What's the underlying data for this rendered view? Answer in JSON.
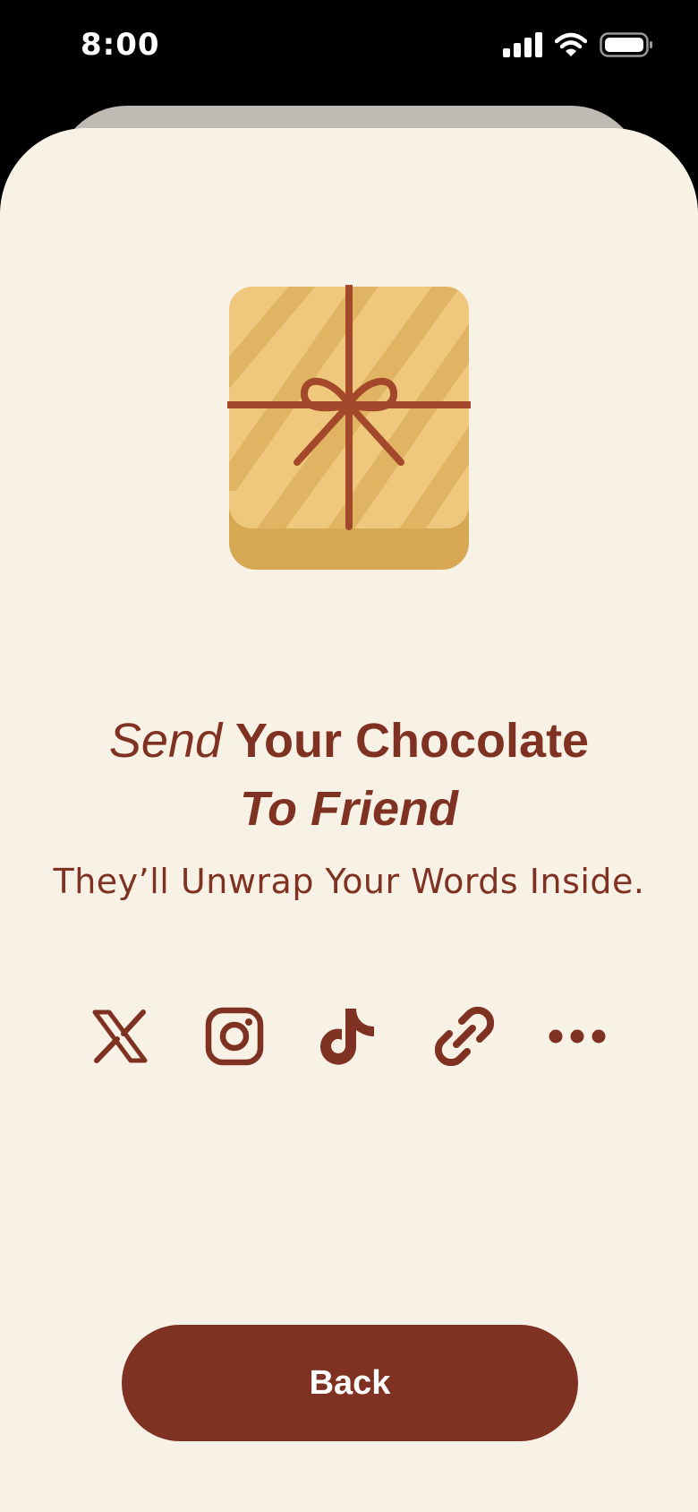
{
  "status_bar": {
    "time": "8:00",
    "icons": [
      "signal-icon",
      "wifi-icon",
      "battery-icon"
    ]
  },
  "headline": {
    "send": "Send",
    "your_chocolate": "Your Chocolate",
    "to_friend": "To Friend"
  },
  "subtitle": "They’ll Unwrap Your Words Inside.",
  "share_options": [
    "x-icon",
    "instagram-icon",
    "tiktok-icon",
    "link-icon",
    "more-icon"
  ],
  "buttons": {
    "back_label": "Back"
  },
  "colors": {
    "background": "#f8f1e5",
    "accent": "#7f3222",
    "gift_light": "#efc87e",
    "gift_dark": "#d6a853"
  }
}
